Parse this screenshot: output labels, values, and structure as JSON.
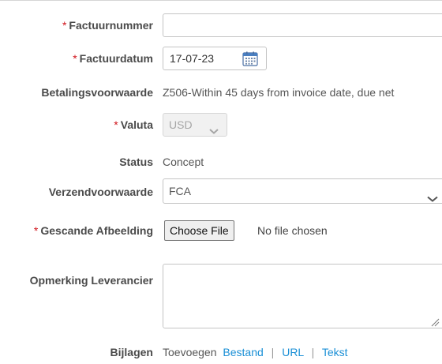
{
  "form": {
    "required_marker": "*",
    "invoice_number": {
      "label": "Factuurnummer",
      "value": ""
    },
    "invoice_date": {
      "label": "Factuurdatum",
      "value": "17-07-23"
    },
    "payment_terms": {
      "label": "Betalingsvoorwaarde",
      "value": "Z506-Within 45 days from invoice date, due net"
    },
    "currency": {
      "label": "Valuta",
      "value": "USD"
    },
    "status": {
      "label": "Status",
      "value": "Concept"
    },
    "shipping_terms": {
      "label": "Verzendvoorwaarde",
      "value": "FCA"
    },
    "scanned_image": {
      "label": "Gescande Afbeelding",
      "button": "Choose File",
      "status": "No file chosen"
    },
    "supplier_note": {
      "label": "Opmerking Leverancier",
      "value": ""
    },
    "attachments": {
      "label": "Bijlagen",
      "add_text": "Toevoegen",
      "links": [
        "Bestand",
        "URL",
        "Tekst"
      ],
      "separator": "|"
    }
  },
  "colors": {
    "required": "#d0131a",
    "link": "#1a8fd6",
    "label": "#4a4a4a"
  },
  "icons": {
    "date_picker": "calendar-icon",
    "dropdown": "chevron-down-icon",
    "resize": "resize-handle-icon"
  }
}
